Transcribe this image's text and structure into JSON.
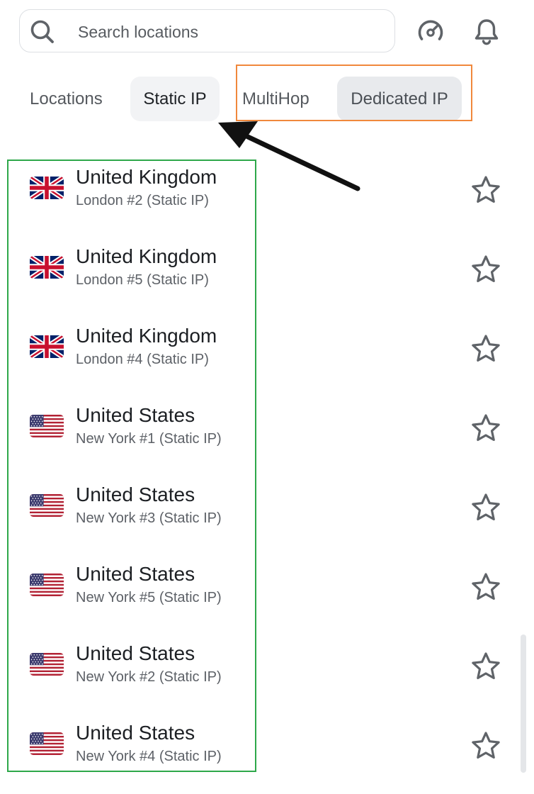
{
  "search": {
    "placeholder": "Search locations",
    "value": ""
  },
  "header_icons": {
    "speed": "speedometer-icon",
    "notifications": "bell-icon"
  },
  "tabs": [
    {
      "label": "Locations",
      "active": false
    },
    {
      "label": "Static IP",
      "active": true
    },
    {
      "label": "MultiHop",
      "active": false
    },
    {
      "label": "Dedicated IP",
      "active": false
    }
  ],
  "locations": [
    {
      "country": "United Kingdom",
      "server": "London #2 (Static IP)",
      "flag": "uk-flag-icon"
    },
    {
      "country": "United Kingdom",
      "server": "London #5 (Static IP)",
      "flag": "uk-flag-icon"
    },
    {
      "country": "United Kingdom",
      "server": "London #4 (Static IP)",
      "flag": "uk-flag-icon"
    },
    {
      "country": "United States",
      "server": "New York #1 (Static IP)",
      "flag": "us-flag-icon"
    },
    {
      "country": "United States",
      "server": "New York #3 (Static IP)",
      "flag": "us-flag-icon"
    },
    {
      "country": "United States",
      "server": "New York #5 (Static IP)",
      "flag": "us-flag-icon"
    },
    {
      "country": "United States",
      "server": "New York #2 (Static IP)",
      "flag": "us-flag-icon"
    },
    {
      "country": "United States",
      "server": "New York #4 (Static IP)",
      "flag": "us-flag-icon"
    }
  ],
  "colors": {
    "annotation_orange": "#f0883c",
    "annotation_green": "#2ea84a",
    "icon_gray": "#5f6368",
    "tab_active_bg": "#f2f3f5"
  }
}
